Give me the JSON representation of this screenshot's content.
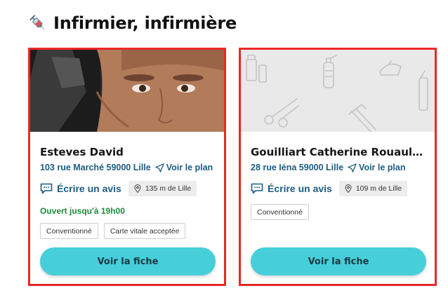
{
  "section": {
    "title": "Infirmier, infirmière",
    "icon": "syringe-icon"
  },
  "colors": {
    "accent_button": "#46cfd9",
    "link_blue": "#1b5d83",
    "open_green": "#1e8a3a",
    "highlight_border": "#f12a2a"
  },
  "cards": [
    {
      "name": "Esteves David",
      "address": "103 rue Marché 59000 Lille",
      "plan_label": "Voir le plan",
      "review_label": "Écrire un avis",
      "distance": "135 m de Lille",
      "open_status": "Ouvert jusqu'à 19h00",
      "tags": [
        "Conventionné",
        "Carte vitale acceptée"
      ],
      "button_label": "Voir la fiche"
    },
    {
      "name": "Gouilliart Catherine Rouault I...",
      "address": "28 rue Iéna 59000 Lille",
      "plan_label": "Voir le plan",
      "review_label": "Écrire un avis",
      "distance": "109 m de Lille",
      "tags": [
        "Conventionné"
      ],
      "button_label": "Voir la fiche"
    }
  ]
}
